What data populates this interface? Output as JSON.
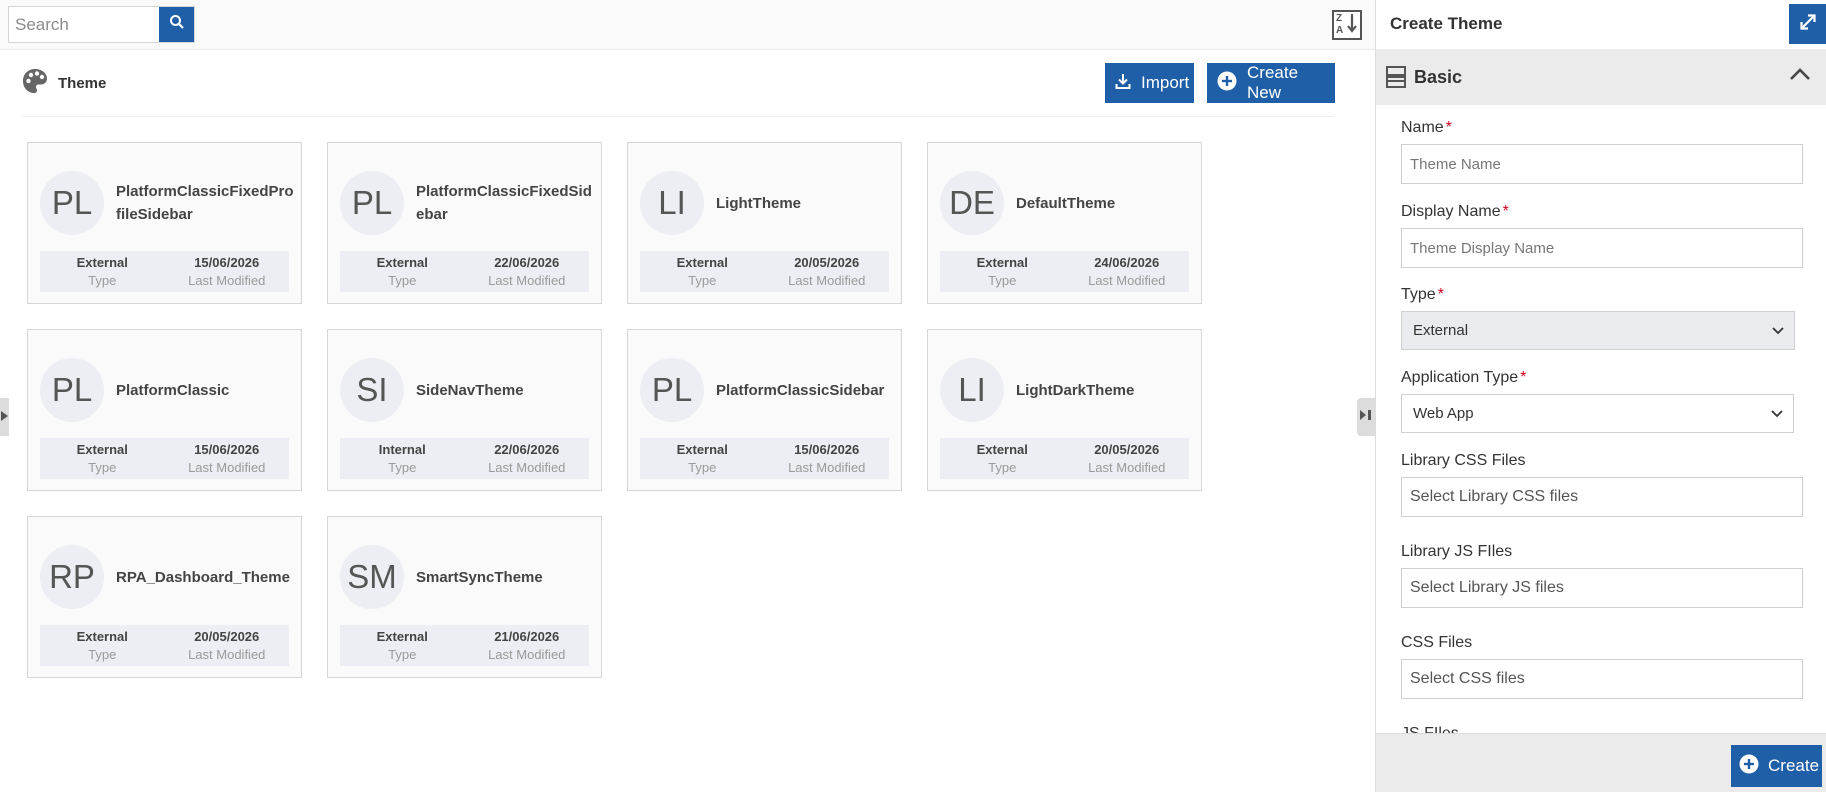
{
  "toolbar": {
    "search_placeholder": "Search",
    "search_icon": "magnifier-icon",
    "sort_icon": "sort-z-a-icon"
  },
  "page": {
    "title": "Theme",
    "title_icon": "palette-icon"
  },
  "actions": {
    "import_label": "Import",
    "create_new_label": "Create New"
  },
  "themes": [
    {
      "initials": "PL",
      "name": "PlatformClassicFixedProfileSidebar",
      "type": "External",
      "type_label": "Type",
      "modified": "15/06/2026",
      "modified_label": "Last Modified"
    },
    {
      "initials": "PL",
      "name": "PlatformClassicFixedSidebar",
      "type": "External",
      "type_label": "Type",
      "modified": "22/06/2026",
      "modified_label": "Last Modified"
    },
    {
      "initials": "LI",
      "name": "LightTheme",
      "type": "External",
      "type_label": "Type",
      "modified": "20/05/2026",
      "modified_label": "Last Modified"
    },
    {
      "initials": "DE",
      "name": "DefaultTheme",
      "type": "External",
      "type_label": "Type",
      "modified": "24/06/2026",
      "modified_label": "Last Modified"
    },
    {
      "initials": "PL",
      "name": "PlatformClassic",
      "type": "External",
      "type_label": "Type",
      "modified": "15/06/2026",
      "modified_label": "Last Modified"
    },
    {
      "initials": "SI",
      "name": "SideNavTheme",
      "type": "Internal",
      "type_label": "Type",
      "modified": "22/06/2026",
      "modified_label": "Last Modified"
    },
    {
      "initials": "PL",
      "name": "PlatformClassicSidebar",
      "type": "External",
      "type_label": "Type",
      "modified": "15/06/2026",
      "modified_label": "Last Modified"
    },
    {
      "initials": "LI",
      "name": "LightDarkTheme",
      "type": "External",
      "type_label": "Type",
      "modified": "20/05/2026",
      "modified_label": "Last Modified"
    },
    {
      "initials": "RP",
      "name": "RPA_Dashboard_Theme",
      "type": "External",
      "type_label": "Type",
      "modified": "20/05/2026",
      "modified_label": "Last Modified"
    },
    {
      "initials": "SM",
      "name": "SmartSyncTheme",
      "type": "External",
      "type_label": "Type",
      "modified": "21/06/2026",
      "modified_label": "Last Modified"
    }
  ],
  "panel": {
    "title": "Create Theme",
    "section_title": "Basic",
    "fields": {
      "name": {
        "label": "Name",
        "placeholder": "Theme Name",
        "required": "*"
      },
      "display_name": {
        "label": "Display Name",
        "placeholder": "Theme Display Name",
        "required": "*"
      },
      "type": {
        "label": "Type",
        "value": "External",
        "required": "*"
      },
      "application_type": {
        "label": "Application Type",
        "value": "Web App",
        "required": "*"
      },
      "library_css": {
        "label": "Library CSS Files",
        "placeholder": "Select Library CSS files"
      },
      "library_js": {
        "label": "Library JS FIles",
        "placeholder": "Select Library JS files"
      },
      "css_files": {
        "label": "CSS Files",
        "placeholder": "Select CSS files"
      },
      "js_files": {
        "label": "JS FIles"
      }
    },
    "create_label": "Create"
  },
  "colors": {
    "accent": "#1f5fa8",
    "required": "#d0021b",
    "card_bg": "#fafafa",
    "meta_bg": "#eceef3",
    "disabled_select_bg": "#e9ebee"
  }
}
